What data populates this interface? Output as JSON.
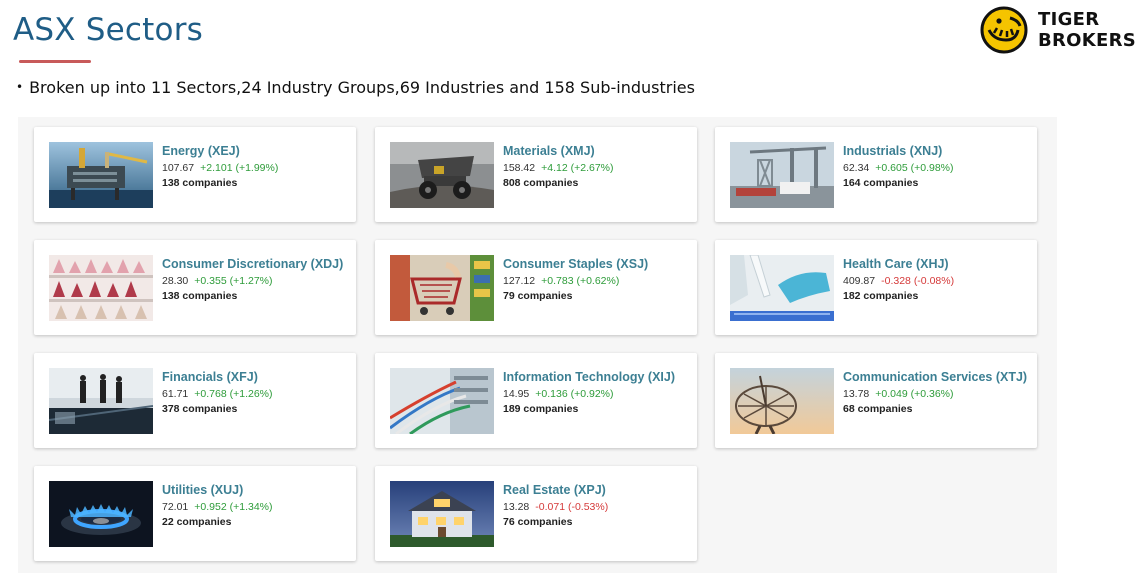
{
  "slide": {
    "title": "ASX Sectors",
    "bullet": "Broken up into 11 Sectors,24 Industry Groups,69 Industries and 158 Sub-industries"
  },
  "logo": {
    "line1": "TIGER",
    "line2": "BROKERS",
    "accent_color": "#f5c400"
  },
  "colors": {
    "title": "#1f5d86",
    "sector_name": "#3c7f93",
    "positive": "#2e9c3a",
    "negative": "#d53a3a"
  },
  "sectors": [
    {
      "name": "Energy (XEJ)",
      "price": "107.67",
      "change": "+2.101 (+1.99%)",
      "direction": "up",
      "companies": "138 companies",
      "image": "oil-rig-image"
    },
    {
      "name": "Materials (XMJ)",
      "price": "158.42",
      "change": "+4.12 (+2.67%)",
      "direction": "up",
      "companies": "808 companies",
      "image": "mining-truck-image"
    },
    {
      "name": "Industrials (XNJ)",
      "price": "62.34",
      "change": "+0.605 (+0.98%)",
      "direction": "up",
      "companies": "164 companies",
      "image": "port-crane-image"
    },
    {
      "name": "Consumer Discretionary (XDJ)",
      "price": "28.30",
      "change": "+0.355 (+1.27%)",
      "direction": "up",
      "companies": "138 companies",
      "image": "shoes-shelf-image"
    },
    {
      "name": "Consumer Staples (XSJ)",
      "price": "127.12",
      "change": "+0.783 (+0.62%)",
      "direction": "up",
      "companies": "79 companies",
      "image": "shopping-cart-image"
    },
    {
      "name": "Health Care (XHJ)",
      "price": "409.87",
      "change": "-0.328 (-0.08%)",
      "direction": "down",
      "companies": "182 companies",
      "image": "lab-pipette-image"
    },
    {
      "name": "Financials (XFJ)",
      "price": "61.71",
      "change": "+0.768 (+1.26%)",
      "direction": "up",
      "companies": "378 companies",
      "image": "business-people-image"
    },
    {
      "name": "Information Technology (XIJ)",
      "price": "14.95",
      "change": "+0.136 (+0.92%)",
      "direction": "up",
      "companies": "189 companies",
      "image": "network-cables-image"
    },
    {
      "name": "Communication Services (XTJ)",
      "price": "13.78",
      "change": "+0.049 (+0.36%)",
      "direction": "up",
      "companies": "68 companies",
      "image": "satellite-dish-image"
    },
    {
      "name": "Utilities (XUJ)",
      "price": "72.01",
      "change": "+0.952 (+1.34%)",
      "direction": "up",
      "companies": "22 companies",
      "image": "gas-flame-image"
    },
    {
      "name": "Real Estate (XPJ)",
      "price": "13.28",
      "change": "-0.071 (-0.53%)",
      "direction": "down",
      "companies": "76 companies",
      "image": "house-image"
    }
  ]
}
